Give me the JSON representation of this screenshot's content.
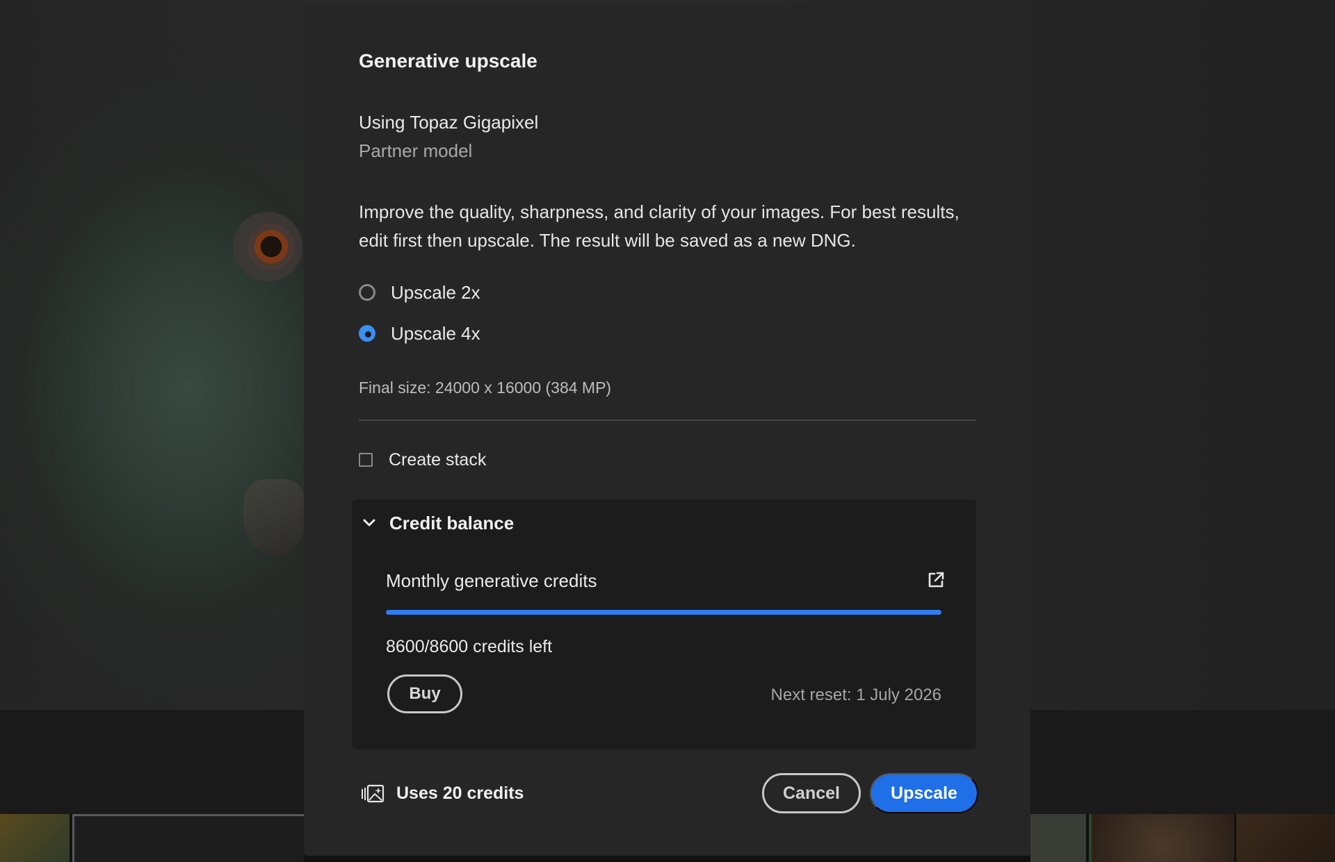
{
  "dialog": {
    "title": "Generative upscale",
    "model_name": "Using Topaz Gigapixel",
    "model_type": "Partner model",
    "description": "Improve the quality, sharpness, and clarity of your images. For best results, edit first then upscale. The result will be saved as a new DNG.",
    "options": [
      {
        "label": "Upscale 2x",
        "selected": false
      },
      {
        "label": "Upscale 4x",
        "selected": true
      }
    ],
    "final_size": "Final size: 24000 x 16000 (384 MP)",
    "create_stack": {
      "label": "Create stack",
      "checked": false
    }
  },
  "credit_balance": {
    "title": "Credit balance",
    "expanded": true,
    "monthly_label": "Monthly generative credits",
    "progress_fraction": 1.0,
    "credits_left": "8600/8600 credits left",
    "buy_label": "Buy",
    "next_reset": "Next reset: 1 July 2026"
  },
  "footer": {
    "uses_credits": "Uses 20 credits",
    "cancel_label": "Cancel",
    "upscale_label": "Upscale"
  },
  "colors": {
    "accent": "#1e6fe8",
    "progress": "#2f7df1",
    "dialog_bg": "#262626",
    "panel_bg": "#1c1c1c"
  },
  "icons": [
    "chevron-down-icon",
    "external-link-icon",
    "credits-icon",
    "radio-icon",
    "checkbox-icon"
  ]
}
